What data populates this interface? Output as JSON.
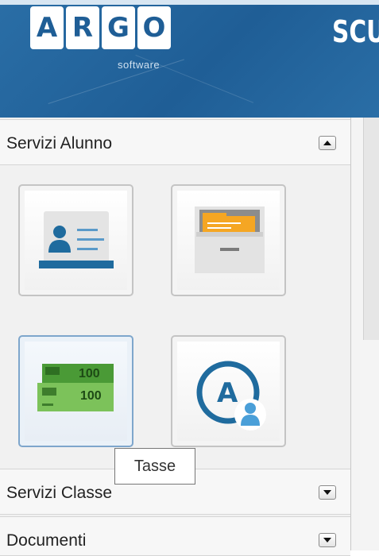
{
  "header": {
    "logo_letters": [
      "A",
      "R",
      "G",
      "O"
    ],
    "logo_subtitle": "software",
    "brand_partial": "SCU",
    "brand_color": "#1f5e96"
  },
  "sections": [
    {
      "title": "Servizi Alunno",
      "state": "expanded",
      "toggle_icon": "collapse-arrow-icon"
    },
    {
      "title": "Servizi Classe",
      "state": "collapsed",
      "toggle_icon": "expand-arrow-icon"
    },
    {
      "title": "Documenti",
      "state": "collapsed",
      "toggle_icon": "expand-arrow-icon"
    }
  ],
  "tiles": [
    {
      "icon": "student-id-card-icon"
    },
    {
      "icon": "file-drawer-icon"
    },
    {
      "icon": "banknotes-icon",
      "note_label": "100",
      "active": true
    },
    {
      "icon": "argo-user-icon",
      "letter": "A"
    }
  ],
  "tooltip": {
    "text": "Tasse"
  },
  "colors": {
    "accent_blue": "#1f6b9e",
    "money_green": "#6cbf4a",
    "folder_orange": "#f5a623"
  }
}
